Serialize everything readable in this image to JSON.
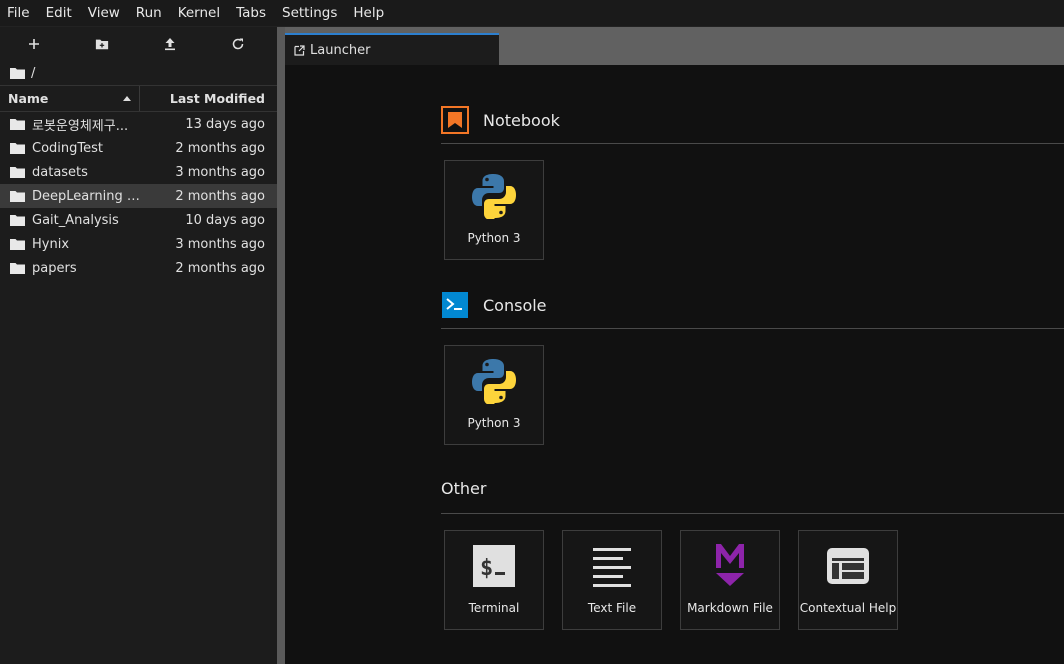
{
  "menu": [
    "File",
    "Edit",
    "View",
    "Run",
    "Kernel",
    "Tabs",
    "Settings",
    "Help"
  ],
  "sidebar": {
    "breadcrumb": "/",
    "header": {
      "name": "Name",
      "modified": "Last Modified"
    },
    "files": [
      {
        "name": "로봇운영체제구...",
        "modified": "13 days ago",
        "selected": false
      },
      {
        "name": "CodingTest",
        "modified": "2 months ago",
        "selected": false
      },
      {
        "name": "datasets",
        "modified": "3 months ago",
        "selected": false
      },
      {
        "name": "DeepLearning St...",
        "modified": "2 months ago",
        "selected": true
      },
      {
        "name": "Gait_Analysis",
        "modified": "10 days ago",
        "selected": false
      },
      {
        "name": "Hynix",
        "modified": "3 months ago",
        "selected": false
      },
      {
        "name": "papers",
        "modified": "2 months ago",
        "selected": false
      }
    ]
  },
  "tab": {
    "label": "Launcher"
  },
  "launcher": {
    "notebook": {
      "title": "Notebook",
      "cards": [
        "Python 3"
      ]
    },
    "console": {
      "title": "Console",
      "cards": [
        "Python 3"
      ]
    },
    "other": {
      "title": "Other",
      "cards": [
        "Terminal",
        "Text File",
        "Markdown File",
        "Contextual Help"
      ]
    }
  },
  "colors": {
    "accent": "#2c7fcf",
    "notebook_icon": "#f37626",
    "console_icon": "#0288d1",
    "markdown_icon": "#7b1fa2"
  }
}
